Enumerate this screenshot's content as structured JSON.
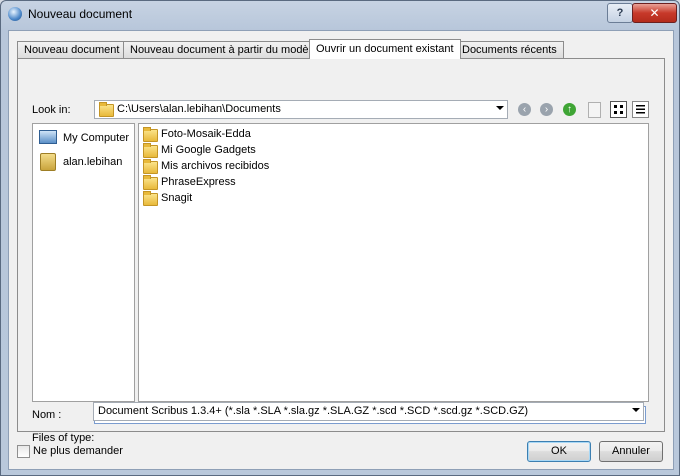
{
  "window": {
    "title": "Nouveau document",
    "help_label": "?",
    "close_label": "✕"
  },
  "tabs": [
    {
      "label": "Nouveau document"
    },
    {
      "label": "Nouveau document à partir du modèle"
    },
    {
      "label": "Ouvrir un document existant",
      "active": true
    },
    {
      "label": "Documents récents"
    }
  ],
  "look_in": {
    "label": "Look in:",
    "path": "C:\\Users\\alan.lebihan\\Documents"
  },
  "toolbar_icons": [
    "back-icon",
    "forward-icon",
    "up-icon",
    "new-folder-icon",
    "list-view-icon",
    "detail-view-icon"
  ],
  "sidebar": {
    "items": [
      {
        "label": "My Computer",
        "icon": "computer-icon"
      },
      {
        "label": "alan.lebihan",
        "icon": "user-folder-icon"
      }
    ]
  },
  "files": [
    {
      "name": "Foto-Mosaik-Edda"
    },
    {
      "name": "Mi Google Gadgets"
    },
    {
      "name": "Mis archivos recibidos"
    },
    {
      "name": "PhraseExpress"
    },
    {
      "name": "Snagit"
    }
  ],
  "name_field": {
    "label": "Nom :",
    "value": ""
  },
  "file_type": {
    "label": "Files of type:",
    "selected": "Document Scribus 1.3.4+ (*.sla *.SLA *.sla.gz *.SLA.GZ *.scd *.SCD *.scd.gz *.SCD.GZ)"
  },
  "footer": {
    "dont_ask_label": "Ne plus demander",
    "dont_ask_checked": false,
    "ok_label": "OK",
    "cancel_label": "Annuler"
  },
  "colors": {
    "nav_grey": "#9aa3ad",
    "nav_green": "#3fa535",
    "close_red": "#c7392a",
    "accent_blue": "#3c7fb1"
  }
}
